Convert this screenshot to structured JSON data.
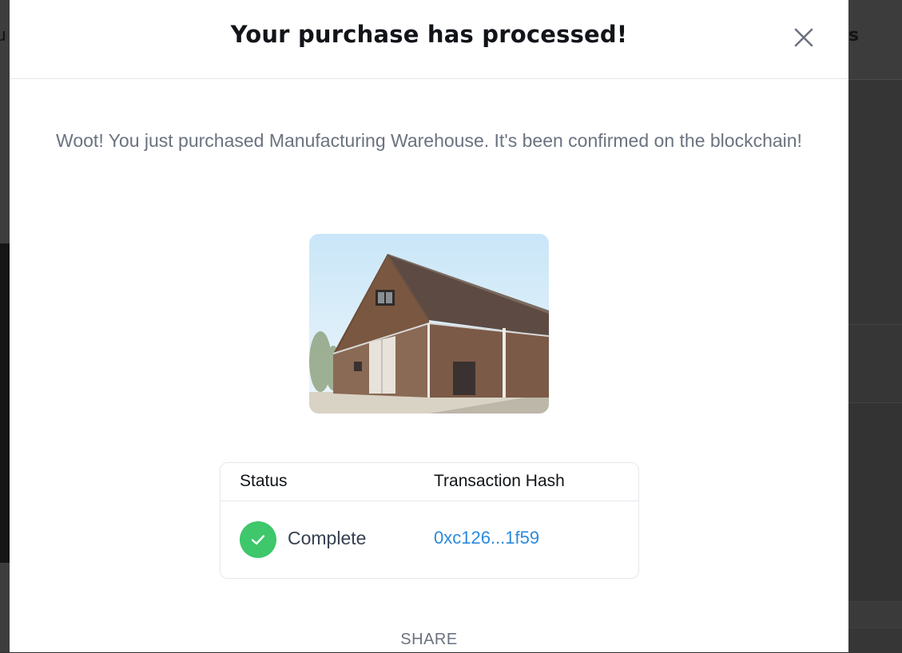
{
  "background": {
    "header_fragment": "s",
    "left_fragment": "u"
  },
  "modal": {
    "title": "Your purchase has processed!",
    "close_icon": "close-icon",
    "message": "Woot! You just purchased Manufacturing Warehouse. It's been confirmed on the blockchain!",
    "image": {
      "icon": "warehouse-photo",
      "subject": "Manufacturing Warehouse"
    },
    "transaction": {
      "headers": {
        "status": "Status",
        "hash": "Transaction Hash"
      },
      "status_value": "Complete",
      "status_icon": "check-icon",
      "hash_value": "0xc126...1f59"
    },
    "share_label": "SHARE"
  },
  "colors": {
    "success": "#3ec76b",
    "link": "#2a8adf",
    "muted_text": "#6b7280",
    "title_text": "#111418"
  }
}
